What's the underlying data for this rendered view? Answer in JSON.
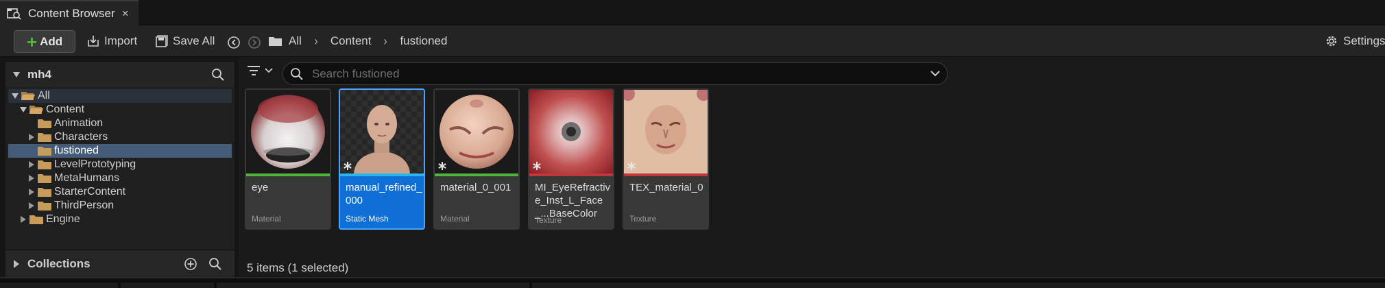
{
  "tab": {
    "title": "Content Browser",
    "close_glyph": "×",
    "icon": "content-browser-icon"
  },
  "toolbar": {
    "add_label": "Add",
    "import_label": "Import",
    "save_all_label": "Save All",
    "settings_label": "Settings"
  },
  "breadcrumb": {
    "items": [
      "All",
      "Content",
      "fustioned"
    ],
    "separator": "›"
  },
  "sources": {
    "project_name": "mh4",
    "tree": [
      {
        "label": "All"
      },
      {
        "label": "Content"
      },
      {
        "label": "Animation"
      },
      {
        "label": "Characters"
      },
      {
        "label": "fustioned"
      },
      {
        "label": "LevelPrototyping"
      },
      {
        "label": "MetaHumans"
      },
      {
        "label": "StarterContent"
      },
      {
        "label": "ThirdPerson"
      },
      {
        "label": "Engine"
      }
    ],
    "selected_folder": "fustioned",
    "collections_label": "Collections"
  },
  "search": {
    "placeholder": "Search fustioned",
    "value": ""
  },
  "assets": [
    {
      "name": "eye",
      "type": "Material",
      "color": "#4cb53a"
    },
    {
      "name": "manual_refined_000",
      "type": "Static Mesh",
      "color": "#25b6f0",
      "selected": true
    },
    {
      "name": "material_0_001",
      "type": "Material",
      "color": "#4cb53a"
    },
    {
      "name": "MI_EyeRefractive_Inst_L_Face_...BaseColor",
      "type": "Texture",
      "color": "#c0363a"
    },
    {
      "name": "TEX_material_0",
      "type": "Texture",
      "color": "#c0363a"
    }
  ],
  "status": {
    "item_count": "5 items (1 selected)"
  },
  "colors": {
    "accent_selected": "#0f6fd6",
    "tree_selected": "#445c77",
    "add_plus": "#53b43a"
  }
}
